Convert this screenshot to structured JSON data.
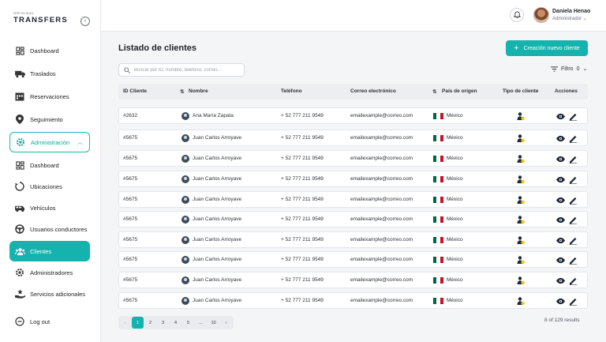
{
  "brand": {
    "small": "ORIGINAL",
    "big": "TRANSFERS"
  },
  "sidebar": {
    "collapse_glyph": "‹",
    "items": [
      {
        "label": "Dashboard",
        "icon": "dashboard-grid-icon"
      },
      {
        "label": "Traslados",
        "icon": "truck-icon"
      },
      {
        "label": "Reservaciones",
        "icon": "calendar-icon"
      },
      {
        "label": "Seguimiento",
        "icon": "map-pin-icon"
      },
      {
        "label": "Administración",
        "icon": "gear-icon",
        "expanded": true
      },
      {
        "label": "Dashboard",
        "icon": "dashboard-grid-icon",
        "sub": true
      },
      {
        "label": "Ubicaciones",
        "icon": "refresh-icon",
        "sub": true
      },
      {
        "label": "Vehículos",
        "icon": "van-icon",
        "sub": true
      },
      {
        "label": "Usuarios conductores",
        "icon": "steering-wheel-icon",
        "sub": true
      },
      {
        "label": "Clientes",
        "icon": "users-icon",
        "sub": true,
        "active": true
      },
      {
        "label": "Administradores",
        "icon": "gear-icon",
        "sub": true
      },
      {
        "label": "Servicios adicionales",
        "icon": "hand-star-icon",
        "sub": true
      }
    ],
    "logout_label": "Log out"
  },
  "header": {
    "user_name": "Daniela Henao",
    "user_role": "Administrador"
  },
  "main": {
    "title": "Listado de clientes",
    "new_button": "Creación nuevo cliente",
    "search_placeholder": "Buscar por ID, nombre, teléfono, correo...",
    "filter_label": "Filtro",
    "filter_count": "0",
    "columns": [
      "ID Cliente",
      "Nombre",
      "Teléfono",
      "Correo electrónico",
      "País de origen",
      "Tipo de cliente",
      "Acciones"
    ],
    "rows": [
      {
        "id": "#2632",
        "name": "Ana María Zapata",
        "phone": "+ 52 777 211 9549",
        "email": "emailexample@correo.com",
        "country": "México"
      },
      {
        "id": "#5675",
        "name": "Juan Carlos Arroyave",
        "phone": "+ 52 777 211 9549",
        "email": "emailexample@correo.com",
        "country": "México"
      },
      {
        "id": "#5675",
        "name": "Juan Carlos Arroyave",
        "phone": "+ 52 777 211 9549",
        "email": "emailexample@correo.com",
        "country": "México"
      },
      {
        "id": "#5675",
        "name": "Juan Carlos Arroyave",
        "phone": "+ 52 777 211 9549",
        "email": "emailexample@correo.com",
        "country": "México"
      },
      {
        "id": "#5675",
        "name": "Juan Carlos Arroyave",
        "phone": "+ 52 777 211 9549",
        "email": "emailexample@correo.com",
        "country": "México"
      },
      {
        "id": "#5675",
        "name": "Juan Carlos Arroyave",
        "phone": "+ 52 777 211 9549",
        "email": "emailexample@correo.com",
        "country": "México"
      },
      {
        "id": "#5675",
        "name": "Juan Carlos Arroyave",
        "phone": "+ 52 777 211 9549",
        "email": "emailexample@correo.com",
        "country": "México"
      },
      {
        "id": "#5675",
        "name": "Juan Carlos Arroyave",
        "phone": "+ 52 777 211 9549",
        "email": "emailexample@correo.com",
        "country": "México"
      },
      {
        "id": "#5675",
        "name": "Juan Carlos Arroyave",
        "phone": "+ 52 777 211 9549",
        "email": "emailexample@correo.com",
        "country": "México"
      },
      {
        "id": "#5675",
        "name": "Juan Carlos Arroyave",
        "phone": "+ 52 777 211 9549",
        "email": "emailexample@correo.com",
        "country": "México"
      }
    ],
    "pagination": [
      "‹",
      "1",
      "2",
      "3",
      "4",
      "5",
      "...",
      "10",
      "›"
    ],
    "current_page": "1",
    "results_text": "8 of 129 results"
  },
  "colors": {
    "accent": "#15b3ad",
    "flag_green": "#006847",
    "flag_red": "#ce1126",
    "client_type_yellow": "#f2c511"
  }
}
